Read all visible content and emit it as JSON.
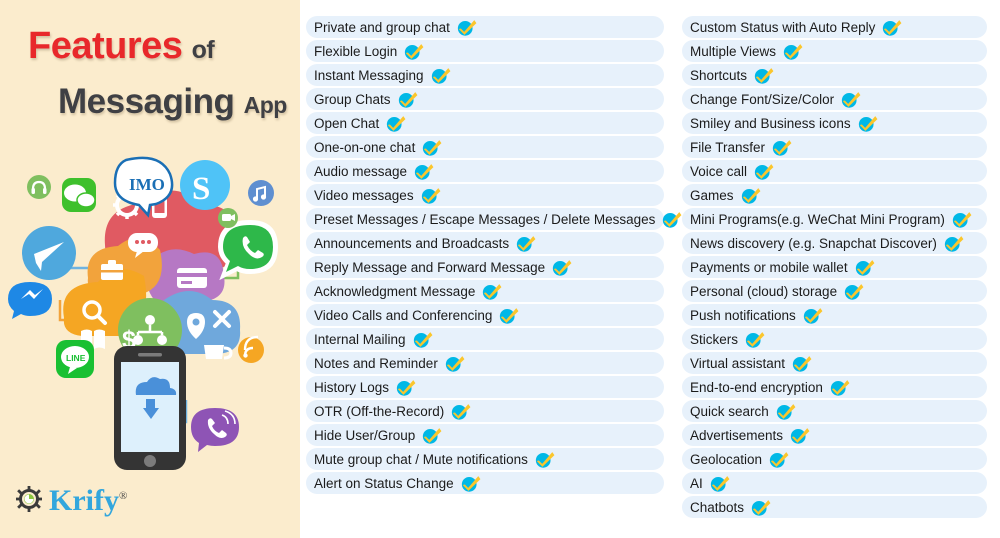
{
  "title": {
    "word_features": "Features",
    "word_of": "of",
    "word_messaging": "Messaging",
    "word_app": "App"
  },
  "brand": {
    "name": "Krify",
    "registered_mark": "®",
    "logo_icon": "gear-icon",
    "color": "#32a6dd"
  },
  "illustration": {
    "alt": "cloud of messaging apps connected to a smartphone",
    "phone_icon": "cloud-download-icon",
    "app_badges": [
      "imo-icon",
      "wechat-icon",
      "skype-icon",
      "telegram-icon",
      "whatsapp-icon",
      "messenger-icon",
      "line-icon",
      "viber-icon",
      "music-icon",
      "rss-icon",
      "headphone-icon",
      "video-icon"
    ],
    "cloud_icons": [
      "gear-icon",
      "mobile-icon",
      "chat-bubble-icon",
      "briefcase-icon",
      "card-icon",
      "search-icon",
      "book-icon",
      "dollar-icon",
      "network-icon",
      "location-icon",
      "wrench-icon",
      "coffee-icon"
    ]
  },
  "check_icon": {
    "name": "check-badge-icon",
    "circle_color": "#00b8e6",
    "tick_color": "#fbc62c"
  },
  "colors": {
    "panel_bg": "#fbeccd",
    "page_bg": "#ffffff",
    "pill_bg": "#e7f1fb",
    "title_accent": "#e8282b",
    "title_dark": "#3f4044"
  },
  "features": {
    "column_left": [
      "Private and group chat",
      "Flexible Login",
      "Instant Messaging",
      "Group Chats",
      "Open Chat",
      "One-on-one chat",
      "Audio message",
      "Video messages",
      "Preset Messages / Escape Messages / Delete Messages",
      "Announcements and Broadcasts",
      "Reply Message and Forward Message",
      "Acknowledgment Message",
      "Video Calls and Conferencing",
      "Internal Mailing",
      "Notes and Reminder",
      "History Logs",
      "OTR (Off-the-Record)",
      "Hide User/Group",
      "Mute group chat / Mute notifications",
      "Alert on Status Change"
    ],
    "column_right": [
      "Custom Status with Auto Reply",
      "Multiple Views",
      "Shortcuts",
      "Change Font/Size/Color",
      "Smiley and Business icons",
      "File Transfer",
      "Voice call",
      "Games",
      "Mini Programs(e.g. WeChat Mini Program)",
      "News discovery (e.g. Snapchat Discover)",
      "Payments or mobile wallet",
      "Personal (cloud) storage",
      "Push notifications",
      "Stickers",
      "Virtual assistant",
      "End-to-end encryption",
      "Quick search",
      "Advertisements",
      "Geolocation",
      "AI",
      "Chatbots"
    ]
  }
}
